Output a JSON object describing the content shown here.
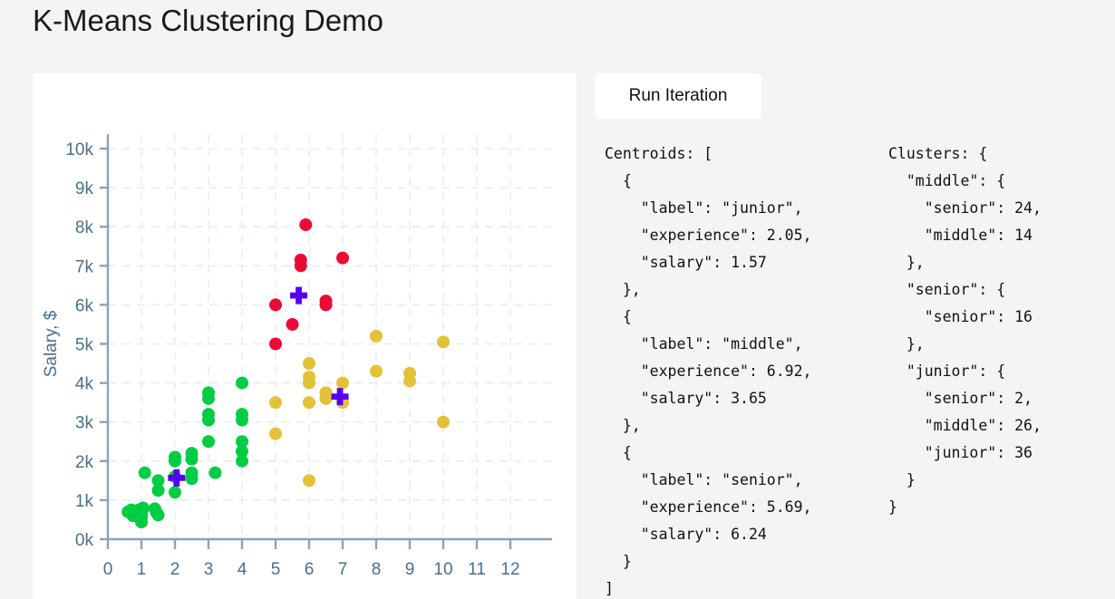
{
  "page": {
    "title": "K-Means Clustering Demo",
    "background_color": "#f4f4f4"
  },
  "toolbar": {
    "run_iteration_label": "Run Iteration"
  },
  "output": {
    "centroids_text": "Centroids: [\n  {\n    \"label\": \"junior\",\n    \"experience\": 2.05,\n    \"salary\": 1.57\n  },\n  {\n    \"label\": \"middle\",\n    \"experience\": 6.92,\n    \"salary\": 3.65\n  },\n  {\n    \"label\": \"senior\",\n    \"experience\": 5.69,\n    \"salary\": 6.24\n  }\n]",
    "clusters_text": "Clusters: {\n  \"middle\": {\n    \"senior\": 24,\n    \"middle\": 14\n  },\n  \"senior\": {\n    \"senior\": 16\n  },\n  \"junior\": {\n    \"senior\": 2,\n    \"middle\": 26,\n    \"junior\": 36\n  }\n}"
  },
  "chart_data": {
    "type": "scatter",
    "title": "",
    "xlabel": "",
    "ylabel": "Salary, $",
    "xlim": [
      0,
      12
    ],
    "ylim": [
      0,
      10000
    ],
    "xticks": [
      0,
      1,
      2,
      3,
      4,
      5,
      6,
      7,
      8,
      9,
      10,
      11,
      12
    ],
    "xtick_labels": [
      "0",
      "1",
      "2",
      "3",
      "4",
      "5",
      "6",
      "7",
      "8",
      "9",
      "10",
      "11",
      "12"
    ],
    "yticks": [
      0,
      1000,
      2000,
      3000,
      4000,
      5000,
      6000,
      7000,
      8000,
      9000,
      10000
    ],
    "ytick_labels": [
      "0k",
      "1k",
      "2k",
      "3k",
      "4k",
      "5k",
      "6k",
      "7k",
      "8k",
      "9k",
      "10k"
    ],
    "grid": true,
    "legend_position": "none",
    "colors": {
      "junior": "#00cc44",
      "middle": "#e3c238",
      "senior": "#eb0a36",
      "centroid": "#5500ee",
      "axis": "#8aa4b4",
      "gridline": "#e8eef1",
      "tick_label": "#4a6f89",
      "panel_background": "#ffffff"
    },
    "marker_radius": 7,
    "series": [
      {
        "name": "junior",
        "color": "#00cc44",
        "points": [
          [
            0.6,
            700
          ],
          [
            0.7,
            750
          ],
          [
            0.75,
            600
          ],
          [
            0.8,
            700
          ],
          [
            0.85,
            720
          ],
          [
            0.95,
            760
          ],
          [
            1.0,
            700
          ],
          [
            1.0,
            620
          ],
          [
            1.0,
            540
          ],
          [
            1.0,
            440
          ],
          [
            1.05,
            800
          ],
          [
            1.1,
            1700
          ],
          [
            1.4,
            780
          ],
          [
            1.45,
            680
          ],
          [
            1.5,
            620
          ],
          [
            1.5,
            1500
          ],
          [
            1.5,
            1250
          ],
          [
            2.0,
            2100
          ],
          [
            2.0,
            2000
          ],
          [
            2.0,
            1600
          ],
          [
            2.0,
            1200
          ],
          [
            2.5,
            2200
          ],
          [
            2.5,
            2050
          ],
          [
            2.5,
            1700
          ],
          [
            2.5,
            1550
          ],
          [
            3.0,
            3750
          ],
          [
            3.0,
            3600
          ],
          [
            3.0,
            3200
          ],
          [
            3.0,
            3050
          ],
          [
            3.0,
            2500
          ],
          [
            3.2,
            1700
          ],
          [
            4.0,
            4000
          ],
          [
            4.0,
            3200
          ],
          [
            4.0,
            3050
          ],
          [
            4.0,
            2500
          ],
          [
            4.0,
            2250
          ],
          [
            4.0,
            2000
          ]
        ]
      },
      {
        "name": "middle",
        "color": "#e3c238",
        "points": [
          [
            5.0,
            3500
          ],
          [
            5.0,
            2700
          ],
          [
            6.0,
            4500
          ],
          [
            6.0,
            4150
          ],
          [
            6.0,
            4000
          ],
          [
            6.0,
            3500
          ],
          [
            6.5,
            3750
          ],
          [
            6.5,
            3600
          ],
          [
            7.0,
            4000
          ],
          [
            7.0,
            3500
          ],
          [
            6.0,
            1500
          ],
          [
            8.0,
            5200
          ],
          [
            8.0,
            4300
          ],
          [
            9.0,
            4250
          ],
          [
            9.0,
            4050
          ],
          [
            10.0,
            5050
          ],
          [
            10.0,
            3000
          ]
        ]
      },
      {
        "name": "senior",
        "color": "#eb0a36",
        "points": [
          [
            5.0,
            6000
          ],
          [
            5.0,
            5000
          ],
          [
            5.5,
            5500
          ],
          [
            5.75,
            7150
          ],
          [
            5.75,
            7000
          ],
          [
            5.9,
            8050
          ],
          [
            6.5,
            6100
          ],
          [
            6.5,
            6000
          ],
          [
            7.0,
            7200
          ]
        ]
      }
    ],
    "centroids": [
      {
        "label": "junior",
        "x": 2.05,
        "y": 1570,
        "color": "#5500ee"
      },
      {
        "label": "middle",
        "x": 6.92,
        "y": 3650,
        "color": "#5500ee"
      },
      {
        "label": "senior",
        "x": 5.69,
        "y": 6240,
        "color": "#5500ee"
      }
    ]
  }
}
